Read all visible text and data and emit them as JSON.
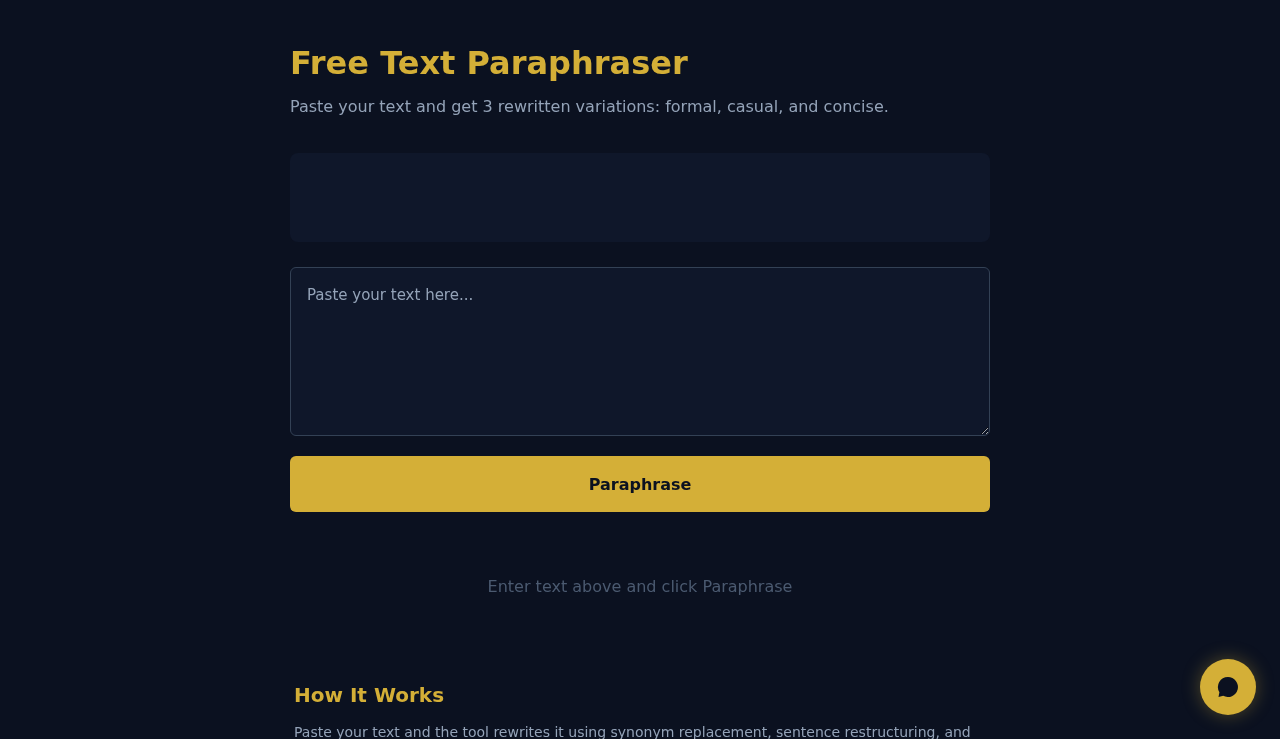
{
  "header": {
    "title": "Free Text Paraphraser",
    "subtitle": "Paste your text and get 3 rewritten variations: formal, casual, and concise."
  },
  "input": {
    "placeholder": "Paste your text here..."
  },
  "paraphrase_button": {
    "label": "Paraphrase"
  },
  "result_area": {
    "empty_message": "Enter text above and click Paraphrase"
  },
  "how_it_works": {
    "title": "How It Works",
    "text": "Paste your text and the tool rewrites it using synonym replacement, sentence restructuring, and"
  }
}
